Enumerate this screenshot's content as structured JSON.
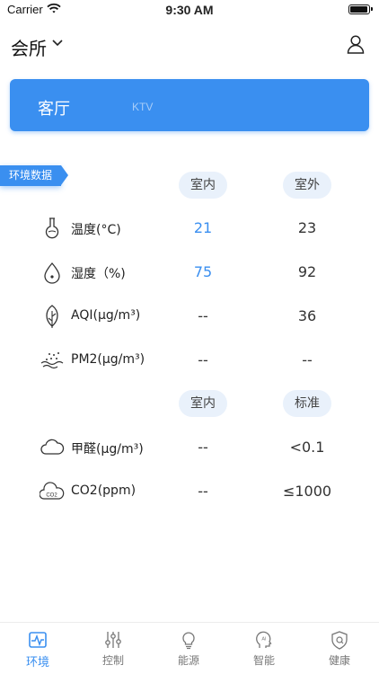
{
  "status_bar": {
    "carrier": "Carrier",
    "time": "9:30 AM",
    "battery_level": 1.0
  },
  "header": {
    "place": "会所",
    "user_icon": "user-icon"
  },
  "rooms": {
    "active": "客厅",
    "other": "KTV"
  },
  "environment": {
    "tag": "环境数据",
    "columns_1": {
      "indoor": "室内",
      "outdoor": "室外"
    },
    "rows_1": [
      {
        "icon": "thermometer-icon",
        "label": "温度(°C)",
        "indoor": "21",
        "outdoor": "23"
      },
      {
        "icon": "droplet-icon",
        "label": "湿度（%)",
        "indoor": "75",
        "outdoor": "92"
      },
      {
        "icon": "leaf-icon",
        "label": "AQI(μg/m³)",
        "indoor": "--",
        "outdoor": "36"
      },
      {
        "icon": "dust-icon",
        "label": "PM2(μg/m³)",
        "indoor": "--",
        "outdoor": "--"
      }
    ],
    "columns_2": {
      "indoor": "室内",
      "standard": "标准"
    },
    "rows_2": [
      {
        "icon": "cloud-icon",
        "label": "甲醛(μg/m³)",
        "indoor": "--",
        "standard": "<0.1"
      },
      {
        "icon": "co2-icon",
        "label": "CO2(ppm)",
        "indoor": "--",
        "standard": "≤1000"
      }
    ]
  },
  "tabs": [
    {
      "label": "环境",
      "icon": "pulse-monitor-icon",
      "active": true
    },
    {
      "label": "控制",
      "icon": "sliders-icon",
      "active": false
    },
    {
      "label": "能源",
      "icon": "lightbulb-icon",
      "active": false
    },
    {
      "label": "智能",
      "icon": "ai-head-icon",
      "active": false
    },
    {
      "label": "健康",
      "icon": "shield-icon",
      "active": false
    }
  ],
  "colors": {
    "accent": "#3a8ff0",
    "pill_bg": "#e9f1fb",
    "inactive_tab": "#777777"
  }
}
